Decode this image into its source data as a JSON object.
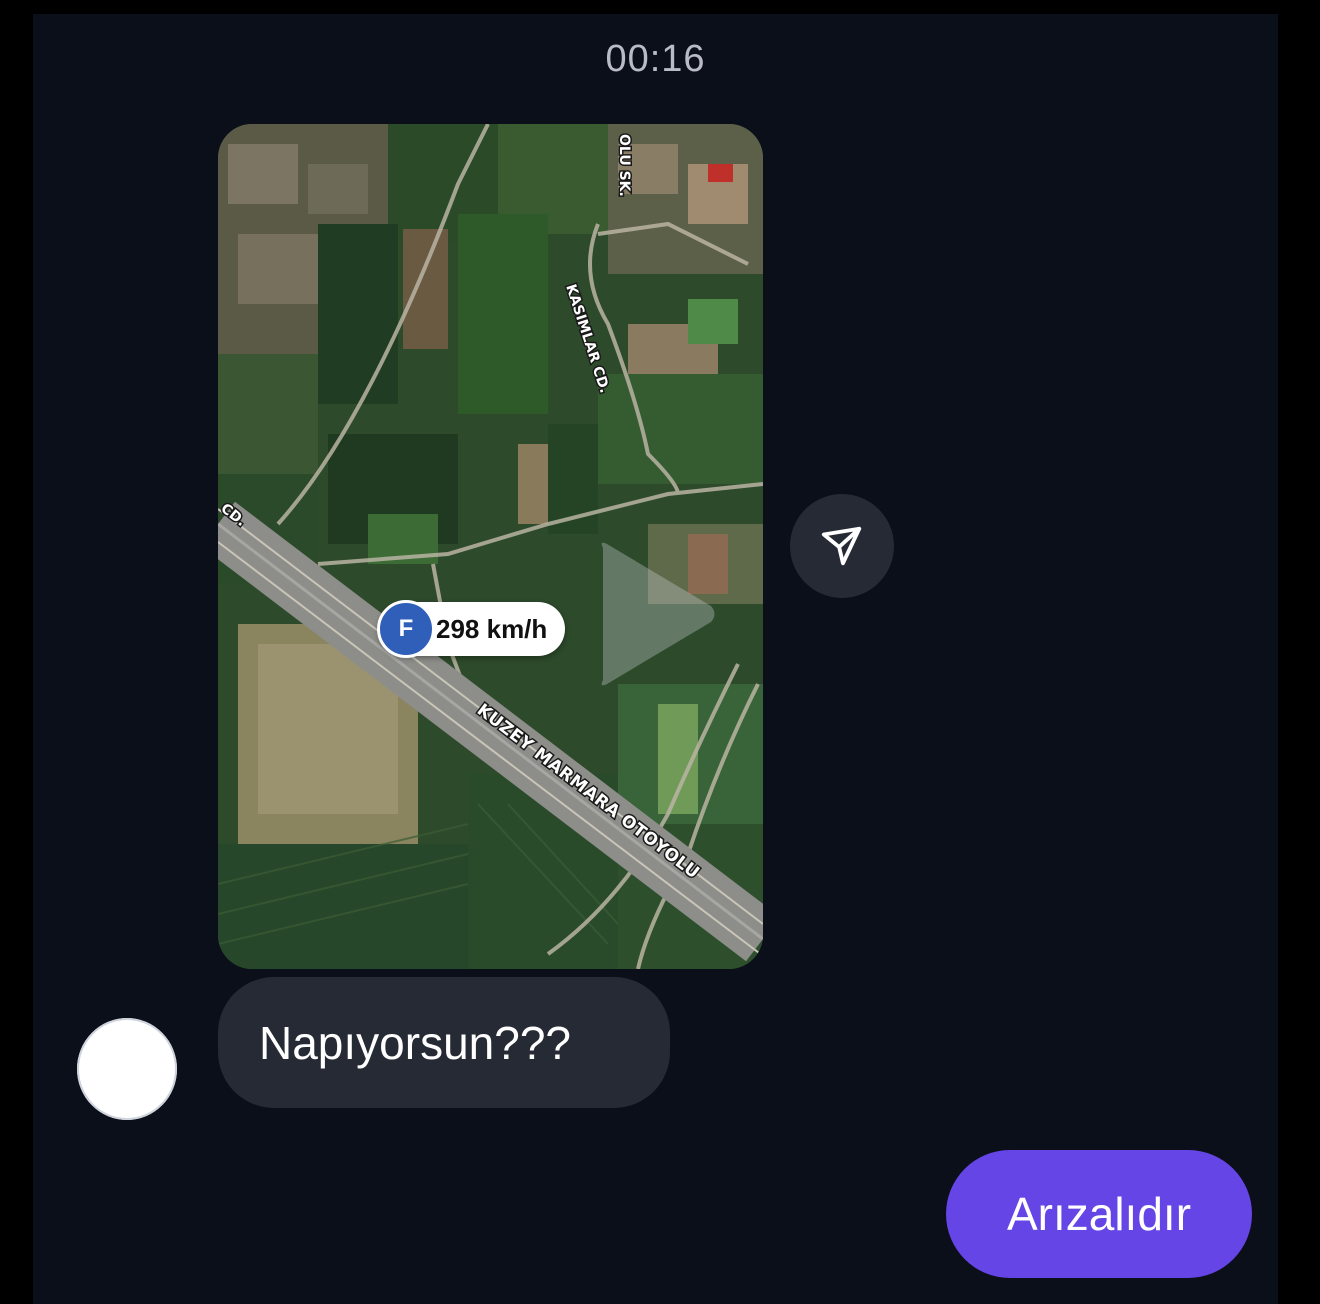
{
  "header": {
    "timestamp": "00:16"
  },
  "map_message": {
    "street_labels": {
      "top_street": "OLU SK.",
      "side_street": "KASIMLAR CD.",
      "edge_street": "CD.",
      "highway": "KUZEY MARMARA OTOYOLU"
    },
    "speed_marker": {
      "badge_letter": "F",
      "speed": "298 km/h",
      "badge_color": "#2f5fb8"
    },
    "media_type_icon": "play-icon"
  },
  "share_button": {
    "icon": "send-icon"
  },
  "incoming_message": {
    "text": "Napıyorsun???",
    "bubble_color": "#262a35"
  },
  "outgoing_message": {
    "text": "Arızalıdır",
    "bubble_color": "#6545e6"
  },
  "colors": {
    "background": "#0b0f1a",
    "accent": "#6545e6"
  }
}
